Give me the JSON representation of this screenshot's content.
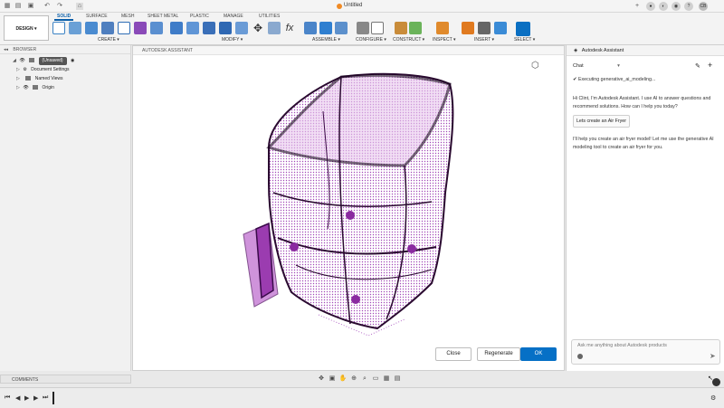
{
  "window": {
    "title": "Untitled"
  },
  "titlebar_right": {
    "avatar_initials": "CB"
  },
  "ribbon": {
    "workspace": "DESIGN ▾",
    "tabs": [
      "SOLID",
      "SURFACE",
      "MESH",
      "SHEET METAL",
      "PLASTIC",
      "MANAGE",
      "UTILITIES"
    ],
    "active_tab": "SOLID",
    "groups": [
      "CREATE ▾",
      "MODIFY ▾",
      "ASSEMBLE ▾",
      "CONFIGURE ▾",
      "CONSTRUCT ▾",
      "INSPECT ▾",
      "INSERT ▾",
      "SELECT ▾"
    ]
  },
  "browser": {
    "header": "BROWSER",
    "root": "(Unsaved)",
    "items": [
      "Document Settings",
      "Named Views",
      "Origin"
    ]
  },
  "canvas": {
    "header": "AUTODESK ASSISTANT",
    "buttons": {
      "close": "Close",
      "regenerate": "Regenerate",
      "ok": "OK"
    }
  },
  "assistant": {
    "title": "Autodesk Assistant",
    "mode": "Chat",
    "status": "Executing generative_ai_modeling...",
    "greeting": "Hi Clint, I'm Autodesk Assistant. I use AI to answer questions and recommend solutions. How can I help you today?",
    "suggestion": "Lets create an Air Fryer",
    "reply": "I'll help you create an air fryer model! Let me use the generative AI modeling tool to create an air fryer for you.",
    "input_placeholder": "Ask me anything about Autodesk products"
  },
  "bottom": {
    "comments_label": "COMMENTS"
  }
}
